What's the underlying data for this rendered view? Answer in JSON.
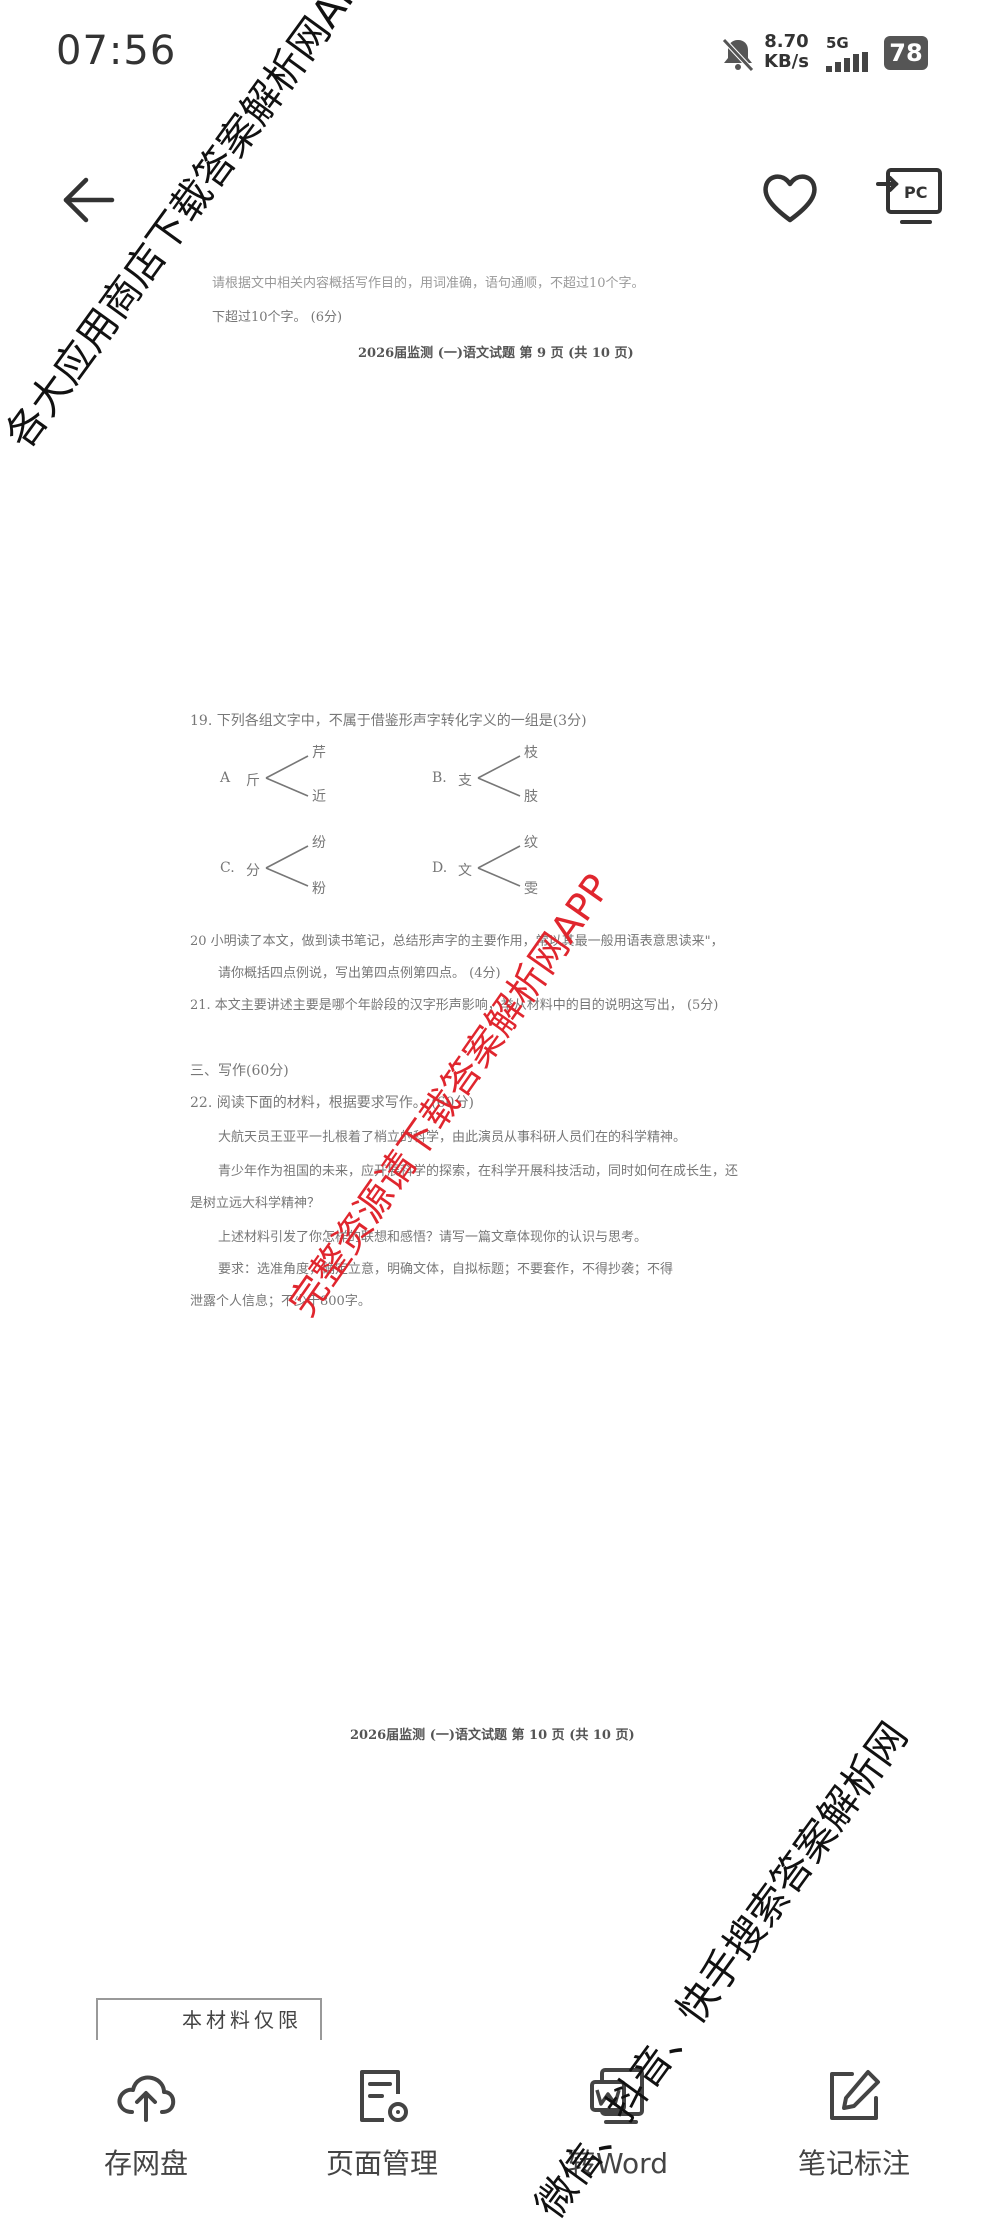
{
  "status": {
    "time": "07:56",
    "net_speed": "8.70",
    "net_unit": "KB/s",
    "network": "5G",
    "battery": "78"
  },
  "topbar": {
    "back_icon": "arrow-left-icon",
    "favorite_icon": "heart-icon",
    "pc_icon": "cast-to-pc-icon",
    "pc_label": "PC"
  },
  "doc": {
    "page9_partial_line": "请根据文中相关内容概括写作目的，用词准确，语句通顺，不超过10个字。",
    "page9_line2": "下超过10个字。    (6分)",
    "page9_footer": "2026届监测 (一)语文试题  第 9 页 (共 10 页)",
    "q19": "19. 下列各组文字中，不属于借鉴形声字转化字义的一组是(3分)",
    "q19_options": [
      {
        "label": "A",
        "root": "斤",
        "upper": "芹",
        "lower": "近"
      },
      {
        "label": "B.",
        "root": "支",
        "upper": "枝",
        "lower": "肢"
      },
      {
        "label": "C.",
        "root": "分",
        "upper": "纷",
        "lower": "粉"
      },
      {
        "label": "D.",
        "root": "文",
        "upper": "纹",
        "lower": "雯"
      }
    ],
    "q20_line1": "20  小明读了本文，做到读书笔记，总结形声字的主要作用，常以其最一般用语表意思读来\"，",
    "q20_line2": "请你概括四点例说，写出第四点例第四点。      (4分)",
    "q21": "21.  本文主要讲述主要是哪个年龄段的汉字形声影响，举从材料中的目的说明这写出，      (5分)",
    "section3": "三、写作(60分)",
    "q22": "22. 阅读下面的材料，根据要求写作。      (60分)",
    "q22_line1": "大航天员王亚平一扎根着了梢立的科学，由此演员从事科研人员们在的科学精神。",
    "q22_line2": "青少年作为祖国的未来，应开展科学的探索，在科学开展科技活动，同时如何在成长生，还",
    "q22_line3": "是树立远大科学精神？",
    "q22_line4": "上述材料引发了你怎样的联想和感悟？请写一篇文章体现你的认识与思考。",
    "q22_line5": "要求：选准角度，确定立意，明确文体，自拟标题；不要套作，不得抄袭；不得",
    "q22_line6": "泄露个人信息；不少于800字。",
    "page10_footer": "2026届监测 (一)语文试题  第 10 页 (共 10 页)",
    "stamp": "本材料仅限"
  },
  "toolbar": {
    "items": [
      {
        "icon": "cloud-upload-icon",
        "label": "存网盘"
      },
      {
        "icon": "page-settings-icon",
        "label": "页面管理"
      },
      {
        "icon": "word-convert-icon",
        "label": "转Word"
      },
      {
        "icon": "edit-note-icon",
        "label": "笔记标注"
      }
    ]
  },
  "watermarks": {
    "top_left": "各大应用商店下载答案解析网APP",
    "center": "完整资源请下载答案解析网APP",
    "bottom_right": "微信、抖音、快手搜索答案解析网"
  }
}
